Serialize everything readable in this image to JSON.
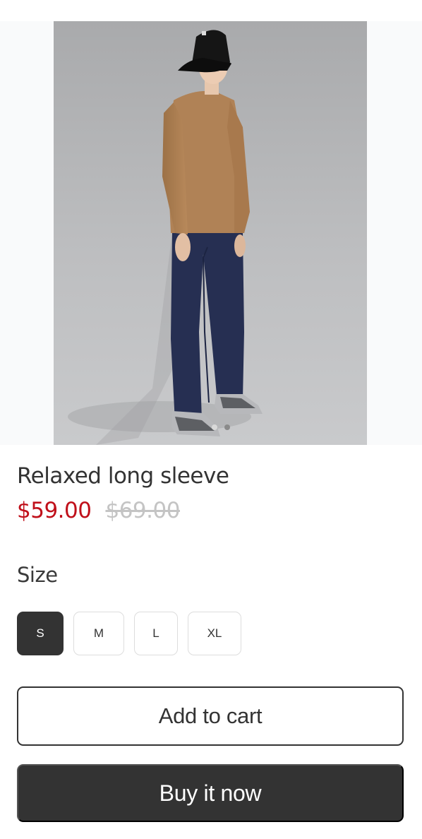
{
  "product": {
    "image_alt": "product-photo",
    "title": "Relaxed long sleeve",
    "price": "$59.00",
    "compare_price": "$69.00"
  },
  "gallery": {
    "slides": 2,
    "active_slide": 1
  },
  "size_selector": {
    "label": "Size",
    "options": [
      "S",
      "M",
      "L",
      "XL"
    ],
    "selected": "S"
  },
  "actions": {
    "add_to_cart": "Add to cart",
    "buy_now": "Buy it now"
  },
  "colors": {
    "sale_price": "#c0101a",
    "primary_button": "#333333"
  }
}
